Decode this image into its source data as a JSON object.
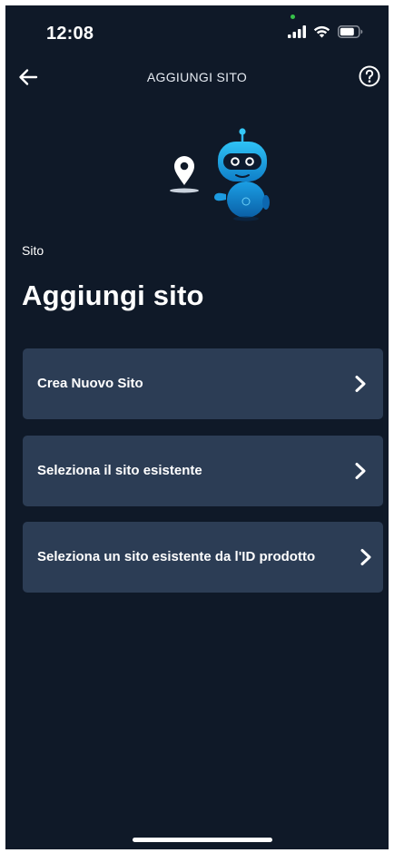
{
  "status_bar": {
    "time": "12:08"
  },
  "header": {
    "title": "AGGIUNGI SITO",
    "back_icon": "arrow-left-icon",
    "help_icon": "question-circle-icon"
  },
  "section_label": "Sito",
  "page_title": "Aggiungi sito",
  "options": [
    {
      "label": "Crea Nuovo Sito"
    },
    {
      "label": "Seleziona il sito esistente"
    },
    {
      "label": "Seleziona un sito esistente da l'ID prodotto"
    }
  ],
  "colors": {
    "background": "#0f1928",
    "card": "#2c3d55",
    "robot_blue": "#1aa5e8",
    "text": "#ffffff"
  }
}
